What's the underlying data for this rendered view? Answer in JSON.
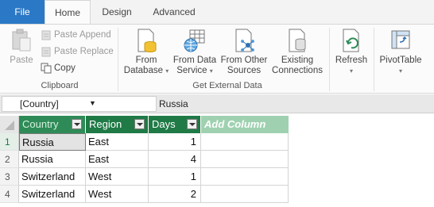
{
  "tabs": {
    "file": "File",
    "home": "Home",
    "design": "Design",
    "advanced": "Advanced"
  },
  "clipboard": {
    "paste": "Paste",
    "paste_append": "Paste Append",
    "paste_replace": "Paste Replace",
    "copy": "Copy",
    "group_label": "Clipboard"
  },
  "external": {
    "from_database": [
      "From",
      "Database"
    ],
    "from_data_service": [
      "From Data",
      "Service"
    ],
    "from_other_sources": [
      "From Other",
      "Sources"
    ],
    "existing_connections": [
      "Existing",
      "Connections"
    ],
    "group_label": "Get External Data"
  },
  "refresh": "Refresh",
  "pivottable": "PivotTable",
  "formula_bar": {
    "name_box": "[Country]",
    "value": "Russia"
  },
  "grid": {
    "columns": [
      "Country",
      "Region",
      "Days"
    ],
    "add_column": "Add Column",
    "row_numbers": [
      "1",
      "2",
      "3",
      "4"
    ],
    "rows": [
      [
        "Russia",
        "East",
        "1"
      ],
      [
        "Russia",
        "East",
        "4"
      ],
      [
        "Switzerland",
        "West",
        "1"
      ],
      [
        "Switzerland",
        "West",
        "2"
      ]
    ]
  },
  "colors": {
    "header_green": "#1f7a46",
    "add_column_green": "#9fd1b1",
    "file_blue": "#2b78c6"
  }
}
